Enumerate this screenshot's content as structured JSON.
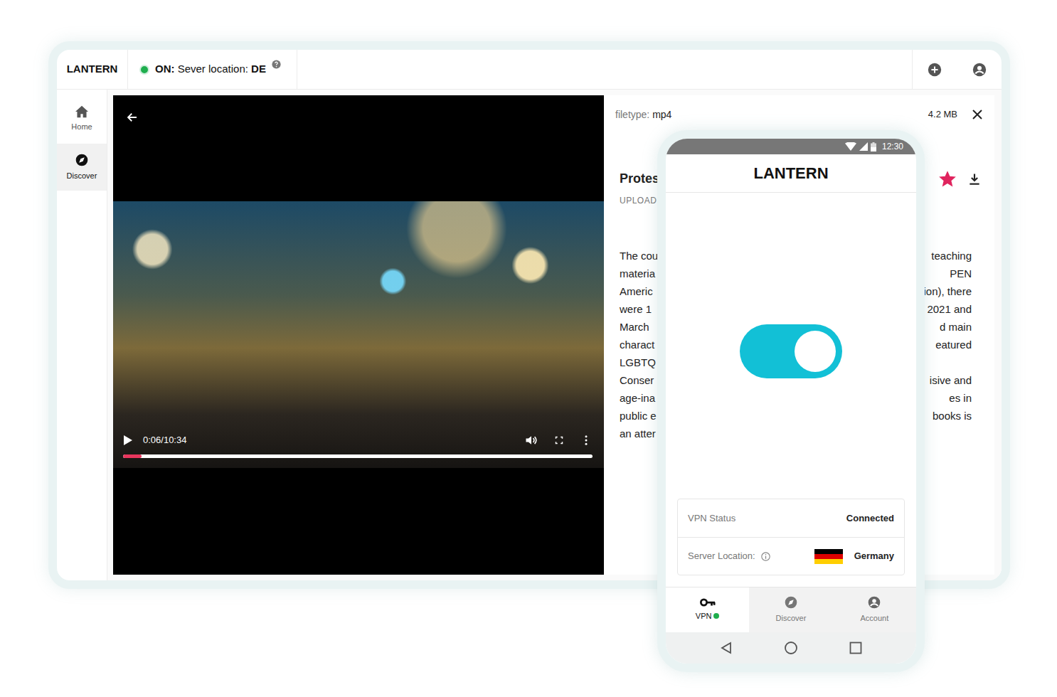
{
  "app": {
    "name": "LANTERN",
    "on": true,
    "status": "ON:",
    "server_label": "Sever location:",
    "server_code": "DE"
  },
  "sidebar": {
    "items": [
      {
        "label": "Home",
        "selected": false
      },
      {
        "label": "Discover",
        "selected": true
      }
    ]
  },
  "video": {
    "time": "0:06/10:34",
    "level": 0.04
  },
  "details": {
    "filetype_label": "filetype:",
    "filetype": "mp4",
    "size": "4.2 MB",
    "title": "Protes",
    "upload": "UPLOAD",
    "favorite": true,
    "lines": [
      {
        "left": "The cou",
        "right": "teaching"
      },
      {
        "left": "materia",
        "right": "PEN"
      },
      {
        "left": "Americ",
        "right": "ion), there"
      },
      {
        "left": "were 1",
        "right": "2021 and"
      },
      {
        "left": "March",
        "right": "d main"
      },
      {
        "left": "charact",
        "right": "eatured"
      },
      {
        "left": "LGBTQ"
      },
      {
        "left": "Conser",
        "right": "isive and"
      },
      {
        "left": "age-ina",
        "right": "es in"
      },
      {
        "left": "public e",
        "right": "books is"
      },
      {
        "left": "an atter"
      }
    ]
  },
  "phone": {
    "time": "12:30",
    "title": "LANTERN",
    "vpn_on": true,
    "rows": [
      {
        "label": "VPN Status",
        "value": "Connected"
      },
      {
        "label": "Server Location:",
        "value": "Germany"
      }
    ],
    "nav": [
      {
        "label": "VPN",
        "selected": true,
        "connected": true
      },
      {
        "label": "Discover",
        "selected": false
      },
      {
        "label": "Account",
        "selected": false
      }
    ]
  }
}
